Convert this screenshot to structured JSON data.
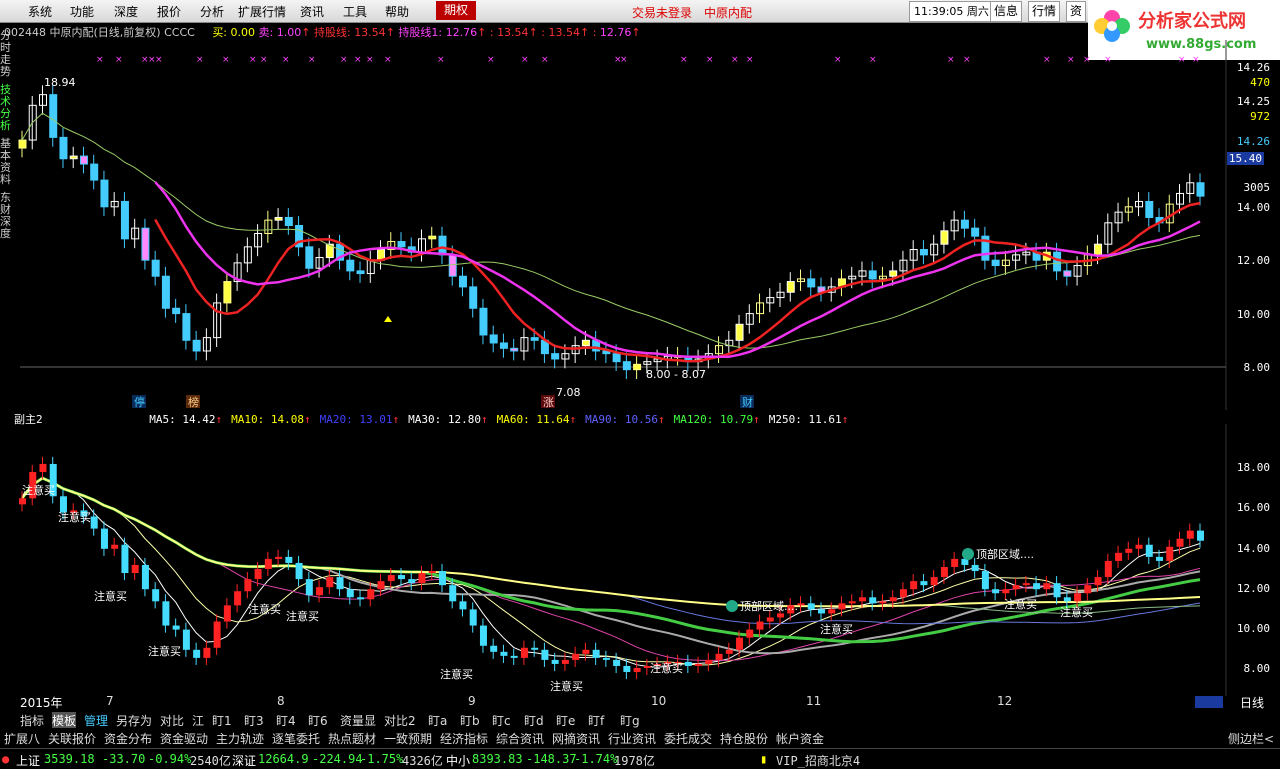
{
  "menu": {
    "items": [
      "系统",
      "功能",
      "深度",
      "报价",
      "分析",
      "扩展行情",
      "资讯",
      "工具",
      "帮助"
    ],
    "active": "期权",
    "status_login": "交易未登录",
    "status_stock": "中原内配",
    "clock": "11:39:05",
    "weekday": "周六",
    "right_buttons": [
      "信息",
      "行情",
      "资"
    ]
  },
  "logo": {
    "title": "分析家公式网",
    "url": "www.88gs.com"
  },
  "sidebar": [
    "分时走势",
    "技术分析",
    "基本资料",
    "东财深度"
  ],
  "chart_header": {
    "code": "002448",
    "name": "中原内配(日线,前复权)",
    "formula": "CCCC",
    "buy_label": "买:",
    "buy_value": "0.00",
    "sell_label": "卖:",
    "sell_value": "1.00",
    "line1_label": "持股线:",
    "line1_value": "13.54",
    "line2_label": "持股线1:",
    "line2_value": "12.76",
    "extra1": "13.54",
    "extra2": "13.54",
    "extra3": "12.76"
  },
  "main_axis": {
    "ticks": [
      "14.00",
      "12.00",
      "10.00",
      "8.00"
    ],
    "top_labels": [
      "14.26",
      "470",
      "14.25",
      "972",
      "14.26",
      "15.40",
      "3005"
    ],
    "price_tag": "15.40"
  },
  "main_annotations": {
    "high": "18.94",
    "low": "7.08",
    "range": "8.00 - 8.07",
    "tags": [
      "停",
      "榜",
      "涨",
      "财"
    ]
  },
  "sub_chart": {
    "title": "副主2",
    "ticks": [
      "18.00",
      "16.00",
      "14.00",
      "12.00",
      "10.00",
      "8.00"
    ],
    "labels": [
      "注意买",
      "注意买",
      "注意买",
      "注意买",
      "注意买",
      "注意买",
      "注意买",
      "注意买",
      "注意买",
      "注意买",
      "注意买",
      "注意买"
    ],
    "zone_label": "顶部区域...."
  },
  "ma_legend": [
    {
      "label": "MA5:",
      "value": "14.42",
      "color": "#ffffff"
    },
    {
      "label": "MA10:",
      "value": "14.08",
      "color": "#ffff00"
    },
    {
      "label": "MA20:",
      "value": "13.01",
      "color": "#4040ff"
    },
    {
      "label": "MA30:",
      "value": "12.80",
      "color": "#ffffff"
    },
    {
      "label": "MA60:",
      "value": "11.64",
      "color": "#ffff00"
    },
    {
      "label": "MA90:",
      "value": "10.56",
      "color": "#6060ff"
    },
    {
      "label": "MA120:",
      "value": "10.79",
      "color": "#40ff40"
    },
    {
      "label": "M250:",
      "value": "11.61",
      "color": "#ffffff"
    }
  ],
  "x_axis": {
    "year": "2015年",
    "months": [
      "7",
      "8",
      "9",
      "10",
      "11",
      "12"
    ],
    "right_label": "日线"
  },
  "bottom_tabs": [
    "指标",
    "模板",
    "管理",
    "另存为",
    "对比",
    "江",
    "盯1",
    "盯3",
    "盯4",
    "盯6",
    "资量显",
    "对比2",
    "盯a",
    "盯b",
    "盯c",
    "盯d",
    "盯e",
    "盯f",
    "盯g"
  ],
  "link_bar": [
    "扩展八",
    "关联报价",
    "资金分布",
    "资金驱动",
    "主力轨迹",
    "逐笔委托",
    "热点题材",
    "一致预期",
    "经济指标",
    "综合资讯",
    "网摘资讯",
    "行业资讯",
    "委托成交",
    "持仓股份",
    "帐户资金"
  ],
  "link_bar_right": "侧边栏<",
  "statusbar": {
    "sh_name": "上证",
    "sh_value": "3539.18",
    "sh_change": "-33.70",
    "sh_pct": "-0.94%",
    "sh_vol": "2540亿",
    "sz_name": "深证",
    "sz_value": "12664.9",
    "sz_change": "-224.94",
    "sz_pct": "-1.75%",
    "sz_vol": "4326亿",
    "zx_name": "中小",
    "zx_value": "8393.83",
    "zx_change": "-148.37",
    "zx_pct": "-1.74%",
    "zx_vol": "1978亿",
    "vip": "VIP_招商北京4"
  }
}
